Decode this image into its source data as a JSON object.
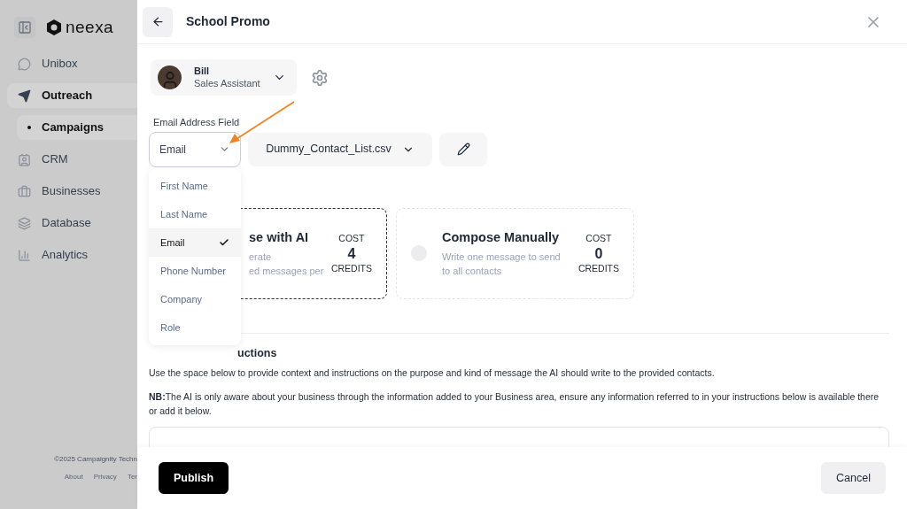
{
  "sidebar": {
    "logo": "neexa",
    "items": [
      {
        "label": "Unibox",
        "selected": false
      },
      {
        "label": "Outreach",
        "selected": true,
        "children": [
          {
            "label": "Campaigns",
            "selected": true
          }
        ]
      },
      {
        "label": "CRM",
        "selected": false
      },
      {
        "label": "Businesses",
        "selected": false
      },
      {
        "label": "Database",
        "selected": false
      },
      {
        "label": "Analytics",
        "selected": false
      }
    ],
    "copyright": "©2025 Campaignity Techn",
    "links": [
      "About",
      "Privacy",
      "Ter"
    ]
  },
  "header": {
    "title": "School Promo"
  },
  "agent": {
    "name": "Bill",
    "role": "Sales Assistant"
  },
  "email_field": {
    "label": "Email Address Field",
    "value": "Email",
    "options": [
      {
        "label": "First Name",
        "selected": false
      },
      {
        "label": "Last Name",
        "selected": false
      },
      {
        "label": "Email",
        "selected": true
      },
      {
        "label": "Phone Number",
        "selected": false
      },
      {
        "label": "Company",
        "selected": false
      },
      {
        "label": "Role",
        "selected": false
      }
    ]
  },
  "contact_list": "Dummy_Contact_List.csv",
  "modes": [
    {
      "title": "se with AI",
      "lines": [
        "erate",
        "ed messages per"
      ],
      "cost_label": "COST",
      "cost": "4",
      "unit": "CREDITS",
      "selected": true
    },
    {
      "title": "Compose Manually",
      "lines": [
        "Write one message to send",
        "to all contacts"
      ],
      "cost_label": "COST",
      "cost": "0",
      "unit": "CREDITS",
      "selected": false
    }
  ],
  "instructions": {
    "heading": "uctions",
    "text": "Use the space below to provide context and instructions on the purpose and kind of message the AI should write to the provided contacts.",
    "note": "**NB:**The AI is only aware about your business through the information added to your Business area, ensure any information referred to in your instructions below is available there or add it below."
  },
  "footer": {
    "publish": "Publish",
    "cancel": "Cancel"
  }
}
